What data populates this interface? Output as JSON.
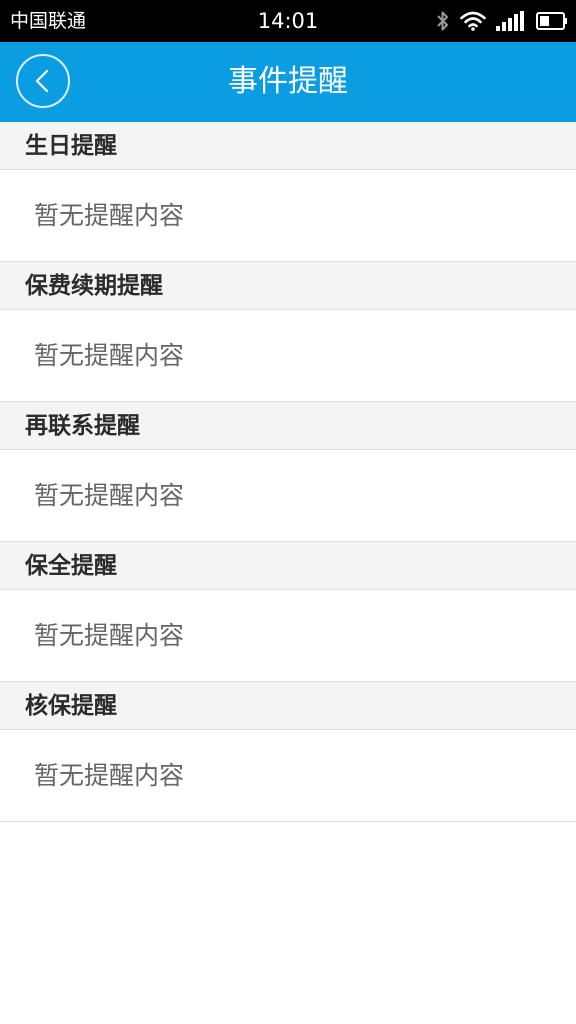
{
  "status_bar": {
    "carrier": "中国联通",
    "time": "14:01",
    "icons": [
      "bluetooth-icon",
      "wifi-icon",
      "signal-icon",
      "battery-icon"
    ]
  },
  "header": {
    "title": "事件提醒",
    "back_icon": "chevron-left-icon",
    "background_color": "#0a9de2"
  },
  "sections": [
    {
      "title": "生日提醒",
      "content": "暂无提醒内容"
    },
    {
      "title": "保费续期提醒",
      "content": "暂无提醒内容"
    },
    {
      "title": "再联系提醒",
      "content": "暂无提醒内容"
    },
    {
      "title": "保全提醒",
      "content": "暂无提醒内容"
    },
    {
      "title": "核保提醒",
      "content": "暂无提醒内容"
    }
  ]
}
